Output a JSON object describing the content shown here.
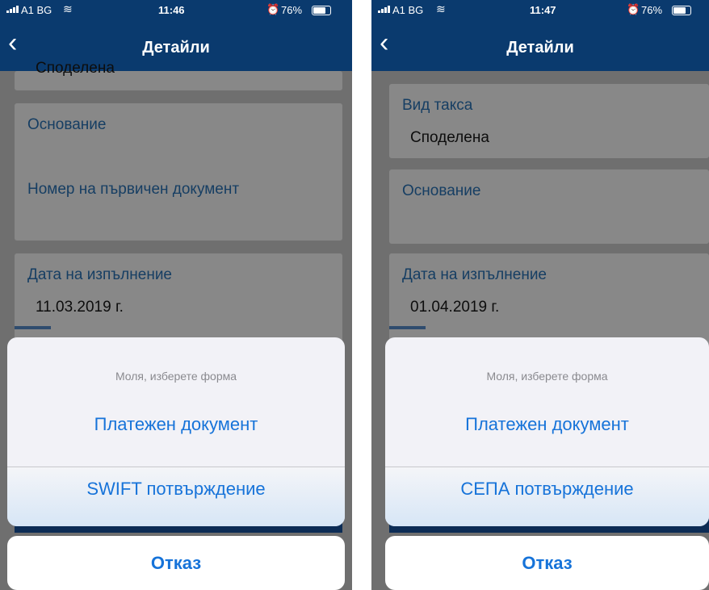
{
  "screens": [
    {
      "status": {
        "carrier": "A1 BG",
        "time": "11:46",
        "battery": "76%",
        "battery_level": 0.76
      },
      "nav": {
        "back": "‹",
        "title": "Детайли"
      },
      "cards": {
        "top_value": "Споделена",
        "osnovanie": "Основание",
        "document_no": "Номер на първичен документ",
        "date_label": "Дата на изпълнение",
        "date_value": "11.03.2019 г."
      },
      "sheet": {
        "prompt": "Моля, изберете форма",
        "option1": "Платежен документ",
        "option2": "SWIFT потвърждение",
        "cancel": "Отказ"
      }
    },
    {
      "status": {
        "carrier": "A1 BG",
        "time": "11:47",
        "battery": "76%",
        "battery_level": 0.76
      },
      "nav": {
        "back": "‹",
        "title": "Детайли"
      },
      "cards": {
        "fee_label": "Вид такса",
        "fee_value": "Споделена",
        "osnovanie": "Основание",
        "date_label": "Дата на изпълнение",
        "date_value": "01.04.2019 г."
      },
      "sheet": {
        "prompt": "Моля, изберете форма",
        "option1": "Платежен документ",
        "option2": "СЕПА потвърждение",
        "cancel": "Отказ"
      }
    }
  ]
}
